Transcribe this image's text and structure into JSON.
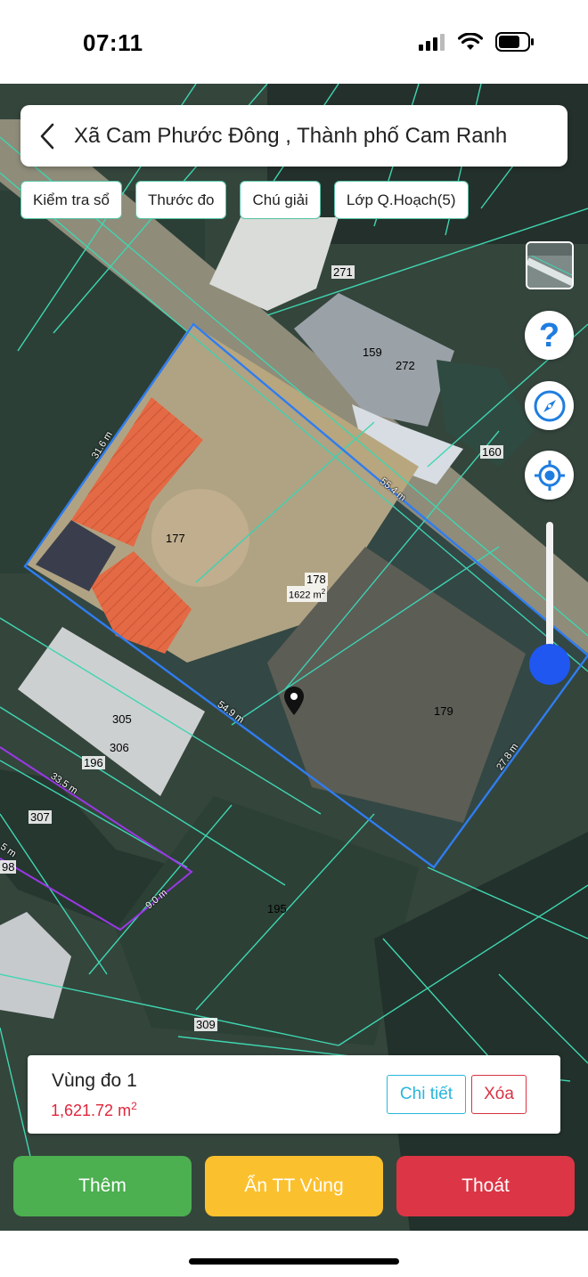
{
  "status_bar": {
    "time": "07:11",
    "icons": [
      "cellular-signal-icon",
      "wifi-icon",
      "battery-icon"
    ]
  },
  "header": {
    "back_icon": "chevron-left-icon",
    "title": "Xã Cam Phước Đông , Thành phố Cam Ranh"
  },
  "toolbar": {
    "chips": [
      "Kiểm tra sổ",
      "Thước đo",
      "Chú giải",
      "Lớp Q.Hoạch(5)"
    ]
  },
  "map_controls": {
    "layer_icon": "map-layer-thumbnail",
    "help_icon": "question-icon",
    "compass_icon": "compass-icon",
    "locate_icon": "locate-icon"
  },
  "map": {
    "plots": [
      "271",
      "159",
      "272",
      "160",
      "177",
      "178",
      "179",
      "305",
      "306",
      "196",
      "307",
      "195",
      "309"
    ],
    "selected_area": "1622 m",
    "dimensions": [
      "31.6 m",
      "55.4 m",
      "54.9 m",
      "27.8 m",
      "33.5 m",
      "9.0 m"
    ],
    "edge_labels": [
      "5 m",
      "98"
    ],
    "colors": {
      "parcel_line": "#3fd6b0",
      "selection": "#2f7df0",
      "planning": "#8a2be2"
    }
  },
  "info_card": {
    "title": "Vùng đo 1",
    "area_value": "1,621.72 m",
    "area_unit_sup": "2",
    "detail_label": "Chi tiết",
    "delete_label": "Xóa"
  },
  "actions": {
    "add_label": "Thêm",
    "hide_label": "Ẩn TT Vùng",
    "exit_label": "Thoát",
    "colors": {
      "add": "#4caf50",
      "hide": "#fbc02d",
      "exit": "#dc3545"
    }
  }
}
